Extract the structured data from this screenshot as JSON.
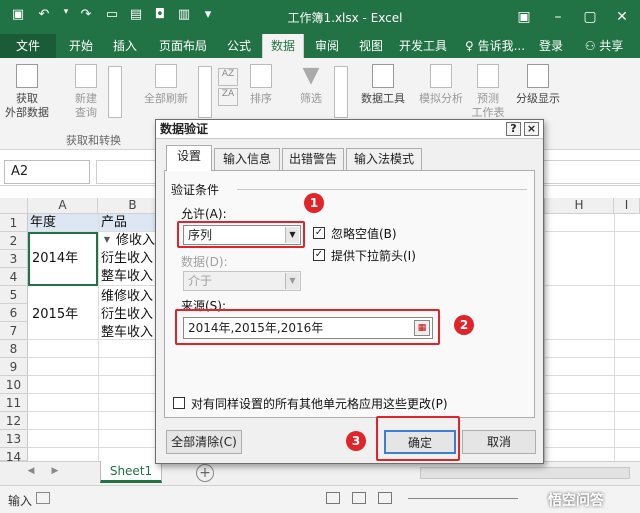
{
  "app": {
    "title": "工作簿1.xlsx - Excel",
    "login": "登录",
    "share": "共享",
    "tell_me": "告诉我...",
    "accent_color": "#217346"
  },
  "tabs": [
    {
      "label": "文件"
    },
    {
      "label": "开始"
    },
    {
      "label": "插入"
    },
    {
      "label": "页面布局"
    },
    {
      "label": "公式"
    },
    {
      "label": "数据"
    },
    {
      "label": "审阅"
    },
    {
      "label": "视图"
    },
    {
      "label": "开发工具"
    }
  ],
  "ribbon": {
    "get_data": "获取\n外部数据",
    "new_query": "新建\n查询",
    "refresh_all": "全部刷新",
    "sort": "排序",
    "filter": "筛选",
    "data_tools": "数据工具",
    "what_if": "模拟分析",
    "forecast": "预测\n工作表",
    "outline": "分级显示",
    "group_get_transform": "获取和转换"
  },
  "formula_bar": {
    "name_box": "A2"
  },
  "sheet": {
    "columns": [
      "A",
      "B",
      "H",
      "I"
    ],
    "rows": [
      "1",
      "2",
      "3",
      "4",
      "5",
      "6",
      "7",
      "8",
      "9",
      "10",
      "11",
      "12",
      "13",
      "14"
    ],
    "header_a": "年度",
    "header_b": "产品",
    "a_2014": "2014年",
    "a_2015": "2015年",
    "b_values": [
      "修收入",
      "衍生收入",
      "整车收入",
      "维修收入",
      "衍生收入",
      "整车收入"
    ],
    "tab_name": "Sheet1"
  },
  "status": {
    "mode": "输入",
    "watermark": "悟空问答"
  },
  "dialog": {
    "title": "数据验证",
    "help": "?",
    "close": "×",
    "tabs": [
      "设置",
      "输入信息",
      "出错警告",
      "输入法模式"
    ],
    "section": "验证条件",
    "allow_label": "允许(A):",
    "allow_value": "序列",
    "ignore_blank": "忽略空值(B)",
    "dropdown": "提供下拉箭头(I)",
    "data_label": "数据(D):",
    "data_value": "介于",
    "source_label": "来源(S):",
    "source_value": "2014年,2015年,2016年",
    "apply_all": "对有同样设置的所有其他单元格应用这些更改(P)",
    "clear_all": "全部清除(C)",
    "ok": "确定",
    "cancel": "取消"
  },
  "annotations": [
    "1",
    "2",
    "3"
  ]
}
